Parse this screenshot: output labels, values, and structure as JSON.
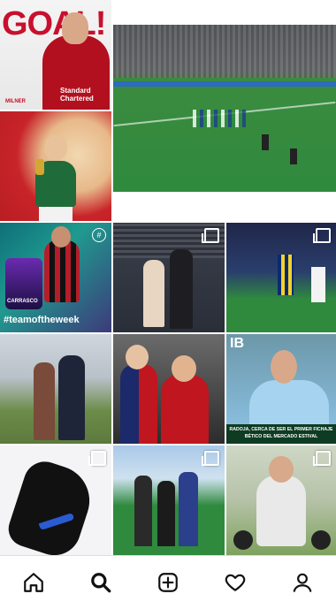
{
  "posts": {
    "goal": {
      "headline": "GOAL!",
      "sponsor": "Standard Chartered",
      "brand": "MILNER"
    },
    "fifa": {
      "hashtag": "#teamoftheweek",
      "player_name": "CARRASCO"
    },
    "news": {
      "logo": "IB",
      "caption": "RADOJA, CERCA DE SER EL PRIMER FICHAJE BÉTICO DEL MERCADO ESTIVAL"
    }
  },
  "tabbar": {
    "items": [
      "home-icon",
      "search-icon",
      "add-post-icon",
      "heart-icon",
      "profile-icon"
    ],
    "active": "search-icon"
  },
  "colors": {
    "liverpool_red": "#c8102e",
    "fifa_purple": "#5a2a8a",
    "pitch_green": "#2f8a3e",
    "celta_blue": "#8ec5e8"
  }
}
